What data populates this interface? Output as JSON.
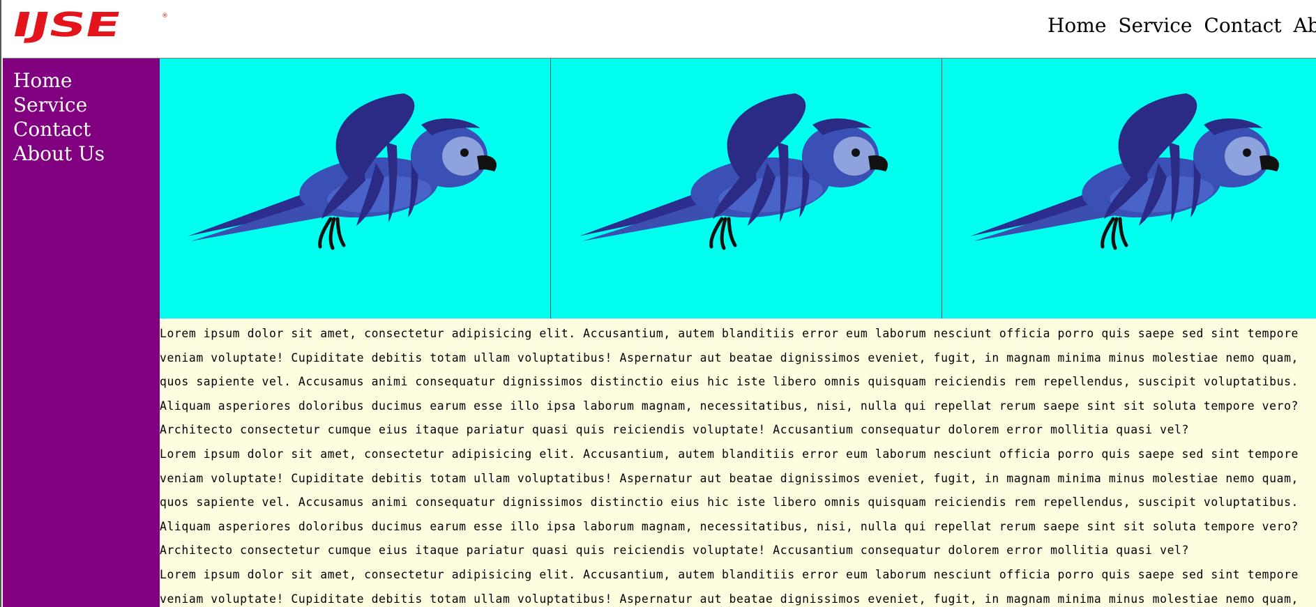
{
  "header": {
    "logo_text": "IJSE",
    "logo_mark": "®",
    "nav": [
      "Home",
      "Service",
      "Contact",
      "About Us"
    ]
  },
  "sidebar": {
    "items": [
      "Home",
      "Service",
      "Contact",
      "About Us"
    ]
  },
  "gallery": {
    "images": [
      "parrot-image",
      "parrot-image",
      "parrot-image"
    ],
    "background": "#00ffef"
  },
  "colors": {
    "brand": "#e3141c",
    "sidebar": "#800080",
    "content_bg": "#fffde0"
  },
  "main": {
    "paragraphs": [
      "Lorem ipsum dolor sit amet, consectetur adipisicing elit. Accusantium, autem blanditiis error eum laborum nesciunt officia porro quis saepe sed sint tempore veniam voluptate! Cupiditate debitis totam ullam voluptatibus! Aspernatur aut beatae dignissimos eveniet, fugit, in magnam minima minus molestiae nemo quam, quos sapiente vel. Accusamus animi consequatur dignissimos distinctio eius hic iste libero omnis quisquam reiciendis rem repellendus, suscipit voluptatibus. Aliquam asperiores doloribus ducimus earum esse illo ipsa laborum magnam, necessitatibus, nisi, nulla qui repellat rerum saepe sint sit soluta tempore vero? Architecto consectetur cumque eius itaque pariatur quasi quis reiciendis voluptate! Accusantium consequatur dolorem error mollitia quasi vel?",
      "Lorem ipsum dolor sit amet, consectetur adipisicing elit. Accusantium, autem blanditiis error eum laborum nesciunt officia porro quis saepe sed sint tempore veniam voluptate! Cupiditate debitis totam ullam voluptatibus! Aspernatur aut beatae dignissimos eveniet, fugit, in magnam minima minus molestiae nemo quam, quos sapiente vel. Accusamus animi consequatur dignissimos distinctio eius hic iste libero omnis quisquam reiciendis rem repellendus, suscipit voluptatibus. Aliquam asperiores doloribus ducimus earum esse illo ipsa laborum magnam, necessitatibus, nisi, nulla qui repellat rerum saepe sint sit soluta tempore vero? Architecto consectetur cumque eius itaque pariatur quasi quis reiciendis voluptate! Accusantium consequatur dolorem error mollitia quasi vel?",
      "Lorem ipsum dolor sit amet, consectetur adipisicing elit. Accusantium, autem blanditiis error eum laborum nesciunt officia porro quis saepe sed sint tempore veniam voluptate! Cupiditate debitis totam ullam voluptatibus! Aspernatur aut beatae dignissimos eveniet, fugit, in magnam minima minus molestiae nemo quam, quos sapiente vel. Accusamus"
    ]
  }
}
